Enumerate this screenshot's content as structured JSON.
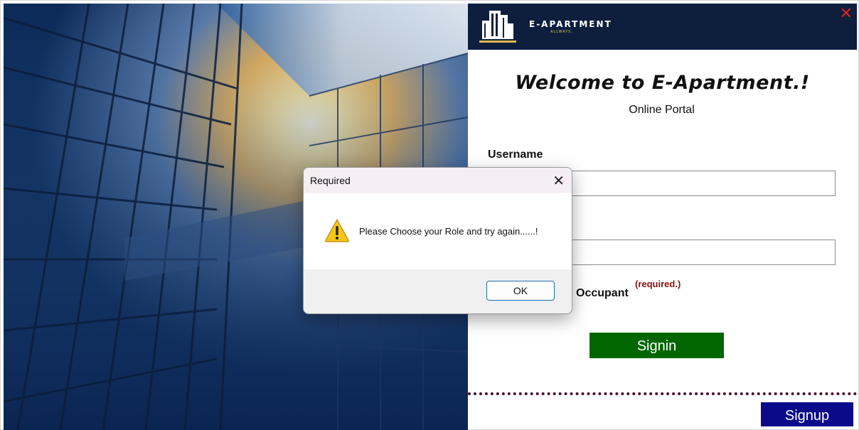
{
  "brand": {
    "name": "E-APARTMENT",
    "tagline": "ALLWAYS."
  },
  "window": {
    "close_glyph": "✕"
  },
  "main": {
    "welcome": "Welcome to E-Apartment.!",
    "subtitle": "Online Portal",
    "username_label": "Username",
    "username_value": "",
    "password_value": "",
    "role_option_label": "Occupant",
    "required_note": "(required.)",
    "signin_label": "Signin",
    "signup_label": "Signup"
  },
  "dialog": {
    "title": "Required",
    "close_glyph": "✕",
    "message": "Please Choose your Role and try again......!",
    "ok_label": "OK",
    "icon": "warning-icon"
  },
  "colors": {
    "header_bg": "#0d1f3d",
    "signin_bg": "#006600",
    "signup_bg": "#0a0a8a",
    "close_red": "#e02424",
    "required_red": "#8b1010"
  }
}
